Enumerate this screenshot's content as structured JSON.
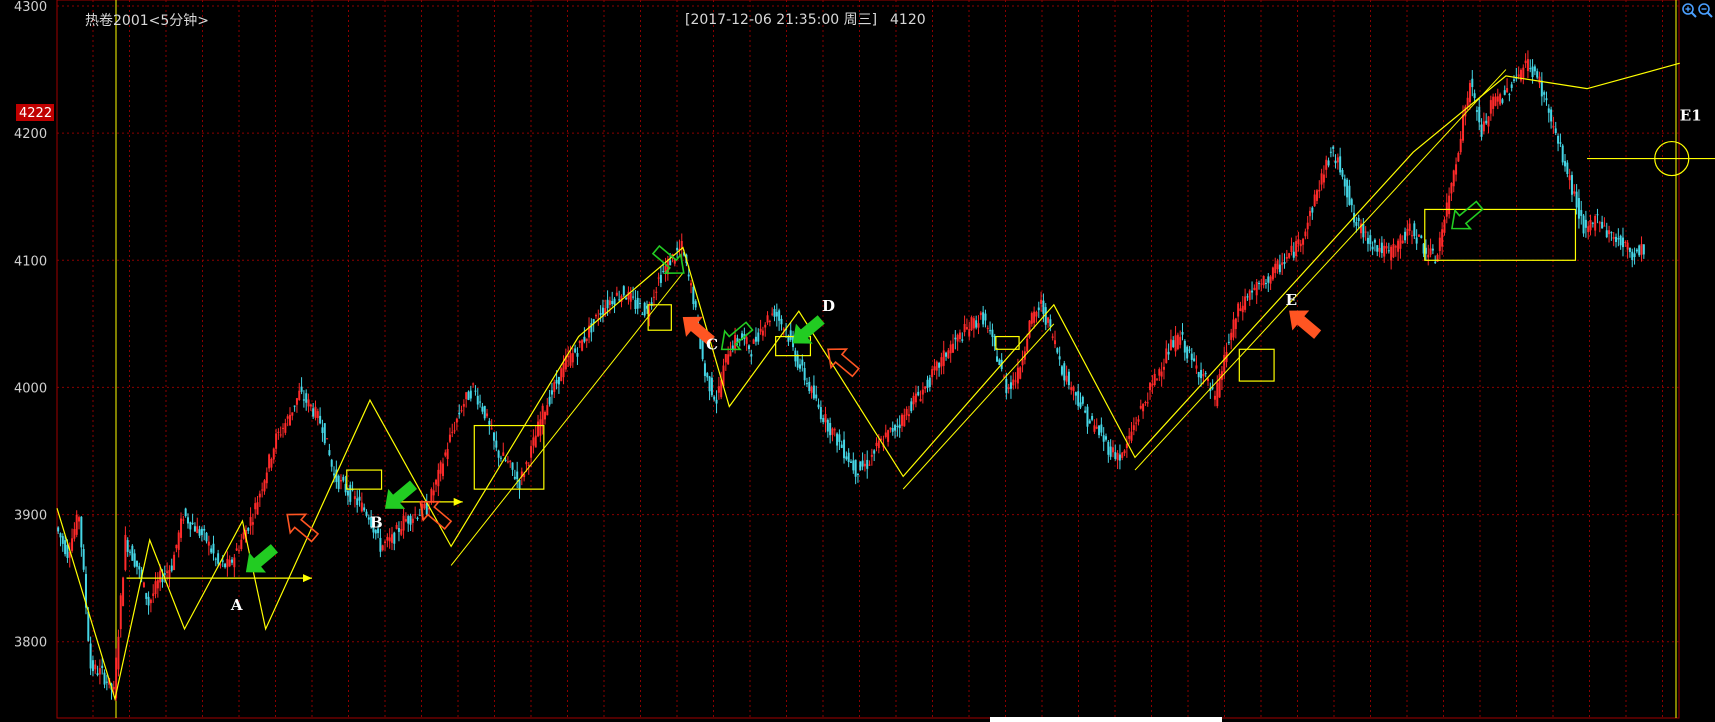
{
  "chart_title": "热卷2001<5分钟>",
  "info": {
    "datetime": "[2017-12-06  21:35:00 周三]",
    "price": "4120"
  },
  "current_price_tag": "4222",
  "colors": {
    "background": "#000000",
    "grid": "#8b0000",
    "axis": "#a00000",
    "up": "#ff2a2a",
    "down": "#45d6e6",
    "zigzag": "#ffff00",
    "green_arrow": "#22cc22",
    "red_arrow": "#ff5522",
    "tag_bg": "#c00000"
  },
  "toolbar": {
    "zoom_in_icon": "zoom-in-icon",
    "zoom_out_icon": "zoom-out-icon"
  },
  "chart_data": {
    "type": "line",
    "series": [
      {
        "values": [
          3890,
          3870,
          3900,
          3780,
          3775,
          3760,
          3880,
          3860,
          3830,
          3850,
          3860,
          3900,
          3890,
          3880,
          3860,
          3860,
          3880,
          3900,
          3930,
          3960,
          3975,
          3995,
          3985,
          3970,
          3930,
          3920,
          3910,
          3900,
          3875,
          3880,
          3895,
          3900,
          3905,
          3930,
          3960,
          3985,
          4000,
          3980,
          3950,
          3940,
          3925,
          3950,
          3980,
          4000,
          4020,
          4030,
          4045,
          4060,
          4070,
          4075,
          4065,
          4060,
          4085,
          4100,
          4110,
          4070,
          4010,
          3990,
          4030,
          4040,
          4030,
          4050,
          4060,
          4045,
          4020,
          4000,
          3980,
          3965,
          3950,
          3935,
          3940,
          3955,
          3965,
          3975,
          3990,
          4000,
          4015,
          4030,
          4040,
          4050,
          4055,
          4030,
          4000,
          4010,
          4050,
          4065,
          4040,
          4010,
          3995,
          3975,
          3965,
          3950,
          3945,
          3970,
          3990,
          4010,
          4030,
          4040,
          4020,
          4010,
          3990,
          4030,
          4060,
          4075,
          4080,
          4090,
          4100,
          4110,
          4130,
          4160,
          4185,
          4170,
          4130,
          4120,
          4110,
          4105,
          4115,
          4125,
          4110,
          4100,
          4140,
          4190,
          4240,
          4200,
          4225,
          4230,
          4245,
          4255,
          4240,
          4210,
          4180,
          4150,
          4120,
          4135,
          4120,
          4115,
          4105,
          4110
        ]
      }
    ],
    "ylim": [
      3740,
      4300
    ],
    "yticks": [
      3800,
      3900,
      4000,
      4100,
      4200,
      4300
    ],
    "grid": true,
    "zigzag": [
      [
        0,
        3905
      ],
      [
        5,
        3755
      ],
      [
        8,
        3880
      ],
      [
        11,
        3810
      ],
      [
        16,
        3895
      ],
      [
        18,
        3810
      ],
      [
        27,
        3990
      ],
      [
        34,
        3875
      ],
      [
        45,
        4040
      ],
      [
        54,
        4110
      ],
      [
        58,
        3985
      ],
      [
        64,
        4060
      ],
      [
        73,
        3930
      ],
      [
        86,
        4065
      ],
      [
        93,
        3945
      ],
      [
        117,
        4185
      ],
      [
        125,
        4245
      ],
      [
        132,
        4235
      ],
      [
        140,
        4255
      ]
    ],
    "boxes": [
      {
        "i0": 25,
        "i1": 28,
        "y0": 3920,
        "y1": 3935
      },
      {
        "i0": 36,
        "i1": 42,
        "y0": 3920,
        "y1": 3970
      },
      {
        "i0": 51,
        "i1": 53,
        "y0": 4045,
        "y1": 4065
      },
      {
        "i0": 62,
        "i1": 65,
        "y0": 4025,
        "y1": 4040
      },
      {
        "i0": 81,
        "i1": 83,
        "y0": 4030,
        "y1": 4040
      },
      {
        "i0": 102,
        "i1": 105,
        "y0": 4005,
        "y1": 4030
      },
      {
        "i0": 118,
        "i1": 131,
        "y0": 4100,
        "y1": 4140
      }
    ],
    "labels": [
      {
        "text": "A",
        "i": 15,
        "y": 3825
      },
      {
        "text": "B",
        "i": 27,
        "y": 3890
      },
      {
        "text": "C",
        "i": 56,
        "y": 4030
      },
      {
        "text": "D",
        "i": 66,
        "y": 4060
      },
      {
        "text": "E",
        "i": 106,
        "y": 4065
      },
      {
        "text": "E1",
        "i": 140,
        "y": 4210
      }
    ],
    "horizontal_arrows": [
      {
        "i0": 6,
        "i1": 22,
        "y": 3850
      },
      {
        "i0": 29,
        "i1": 35,
        "y": 3910
      },
      {
        "i0": 132,
        "i1": 147,
        "y": 4180
      }
    ]
  }
}
